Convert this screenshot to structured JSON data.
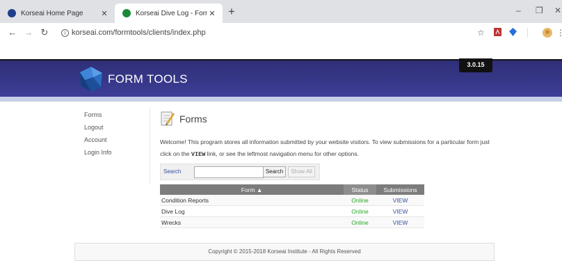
{
  "browser": {
    "tabs": [
      {
        "title": "Korseai Home Page",
        "active": false,
        "favicon_color": "#1f3f8a"
      },
      {
        "title": "Korseai Dive Log - Forms",
        "active": true,
        "favicon_color": "#1a8a3a"
      }
    ],
    "new_tab": "+",
    "url": "korseai.com/formtools/clients/index.php",
    "window_controls": {
      "minimize": "–",
      "restore": "❐",
      "close": "✕"
    }
  },
  "header": {
    "brand": "FORM TOOLS",
    "version": "3.0.15",
    "colors": {
      "banner": "#34348a",
      "accent": "#c5cfe6"
    }
  },
  "nav": {
    "items": [
      "Forms",
      "Logout",
      "Account",
      "Login Info"
    ]
  },
  "main": {
    "title": "Forms",
    "intro_before": "Welcome! This program stores all information submitted by your website visitors. To view submissions for a particular form just click on the ",
    "intro_bold": "VIEW",
    "intro_after": " link, or see the leftmost navigation menu for other options.",
    "search": {
      "label": "Search",
      "search_button": "Search",
      "show_all_button": "Show All",
      "value": ""
    },
    "table": {
      "headers": {
        "form": "Form ▲",
        "status": "Status",
        "submissions": "Submissions"
      },
      "rows": [
        {
          "form": "Condition Reports",
          "status": "Online",
          "action": "VIEW"
        },
        {
          "form": "Dive Log",
          "status": "Online",
          "action": "VIEW"
        },
        {
          "form": "Wrecks",
          "status": "Online",
          "action": "VIEW"
        }
      ]
    }
  },
  "footer": {
    "text": "Copyright © 2015-2018 Korseai Institute - All Rights Reserved"
  }
}
